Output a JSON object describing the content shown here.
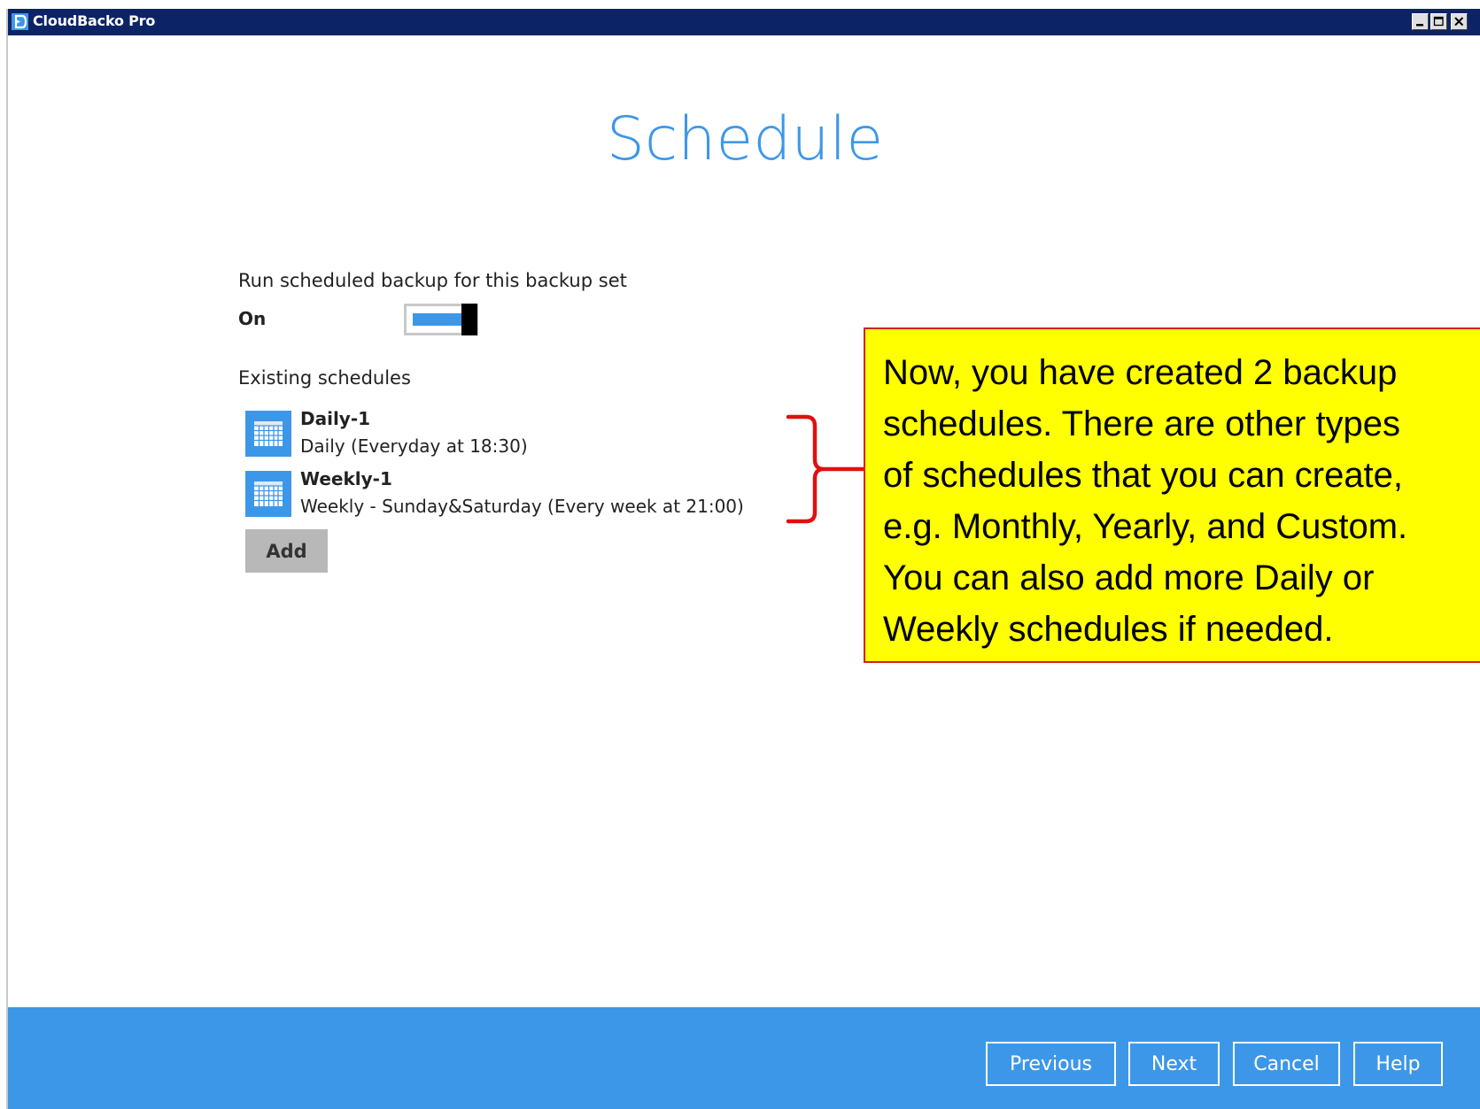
{
  "window": {
    "title": "CloudBacko Pro",
    "controls": {
      "minimize": "minimize-icon",
      "maximize": "maximize-icon",
      "close": "close-icon"
    }
  },
  "page": {
    "title": "Schedule"
  },
  "schedule_settings": {
    "run_label": "Run scheduled backup for this backup set",
    "toggle_state_label": "On",
    "toggle_on": true,
    "existing_label": "Existing schedules",
    "items": [
      {
        "name": "Daily-1",
        "description": "Daily (Everyday at 18:30)",
        "icon": "calendar-icon"
      },
      {
        "name": "Weekly-1",
        "description": "Weekly - Sunday&Saturday (Every week at 21:00)",
        "icon": "calendar-icon"
      }
    ],
    "add_label": "Add"
  },
  "callout": {
    "lines": [
      "Now, you have created  2 backup",
      "schedules. There are other types",
      "of schedules that you can create,",
      "e.g. Monthly, Yearly, and Custom.",
      "You can also add more Daily or",
      "Weekly schedules if needed."
    ]
  },
  "footer": {
    "previous_label": "Previous",
    "next_label": "Next",
    "cancel_label": "Cancel",
    "help_label": "Help"
  },
  "colors": {
    "title_bar": "#0c2466",
    "accent": "#3d97e8",
    "callout_bg": "#ffff00",
    "callout_border": "#d62020",
    "add_button": "#b8b8b8"
  }
}
